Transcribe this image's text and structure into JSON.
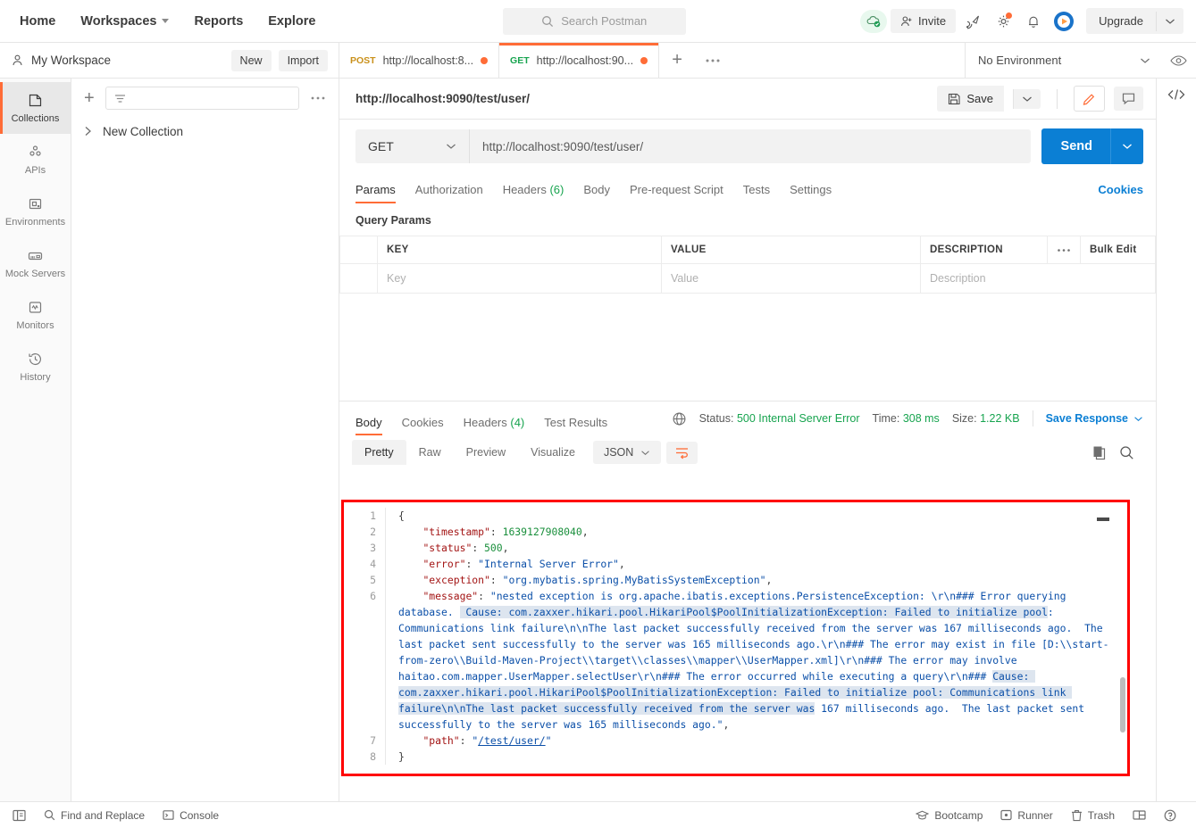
{
  "header": {
    "nav": [
      {
        "label": "Home",
        "icon": ""
      },
      {
        "label": "Workspaces",
        "icon": "chevron-down-icon"
      },
      {
        "label": "Reports",
        "icon": ""
      },
      {
        "label": "Explore",
        "icon": ""
      }
    ],
    "search_placeholder": "Search Postman",
    "invite_label": "Invite",
    "upgrade_label": "Upgrade",
    "icons": [
      "cloud-sync-icon",
      "invite-icon",
      "satellite-icon",
      "gear-icon",
      "bell-icon",
      "postman-avatar-icon",
      "chevron-down-icon"
    ]
  },
  "workspace": {
    "name": "My Workspace",
    "new_label": "New",
    "import_label": "Import"
  },
  "request_tabs": [
    {
      "method": "POST",
      "url": "http://localhost:8...",
      "unsaved": true,
      "active": false
    },
    {
      "method": "GET",
      "url": "http://localhost:90...",
      "unsaved": true,
      "active": true
    }
  ],
  "environment": {
    "selected": "No Environment"
  },
  "sidebar": {
    "items": [
      {
        "label": "Collections",
        "icon": "collections-icon",
        "active": true
      },
      {
        "label": "APIs",
        "icon": "apis-icon",
        "active": false
      },
      {
        "label": "Environments",
        "icon": "environments-icon",
        "active": false
      },
      {
        "label": "Mock Servers",
        "icon": "mock-servers-icon",
        "active": false
      },
      {
        "label": "Monitors",
        "icon": "monitors-icon",
        "active": false
      },
      {
        "label": "History",
        "icon": "history-icon",
        "active": false
      }
    ]
  },
  "collections": {
    "filter_placeholder": "",
    "items": [
      {
        "label": "New Collection"
      }
    ]
  },
  "request": {
    "title": "http://localhost:9090/test/user/",
    "save_label": "Save",
    "method": "GET",
    "url": "http://localhost:9090/test/user/",
    "send_label": "Send",
    "tabs": [
      {
        "label": "Params",
        "count": "",
        "active": true
      },
      {
        "label": "Authorization",
        "count": "",
        "active": false
      },
      {
        "label": "Headers",
        "count": "(6)",
        "active": false
      },
      {
        "label": "Body",
        "count": "",
        "active": false
      },
      {
        "label": "Pre-request Script",
        "count": "",
        "active": false
      },
      {
        "label": "Tests",
        "count": "",
        "active": false
      },
      {
        "label": "Settings",
        "count": "",
        "active": false
      }
    ],
    "cookies_label": "Cookies",
    "query_params_label": "Query Params",
    "params_table": {
      "headers": [
        "KEY",
        "VALUE",
        "DESCRIPTION"
      ],
      "bulk_edit_label": "Bulk Edit",
      "rows": [
        {
          "key": "Key",
          "value": "Value",
          "description": "Description"
        }
      ]
    }
  },
  "response": {
    "tabs": [
      {
        "label": "Body",
        "count": "",
        "active": true
      },
      {
        "label": "Cookies",
        "count": "",
        "active": false
      },
      {
        "label": "Headers",
        "count": "(4)",
        "active": false
      },
      {
        "label": "Test Results",
        "count": "",
        "active": false
      }
    ],
    "status_label": "Status:",
    "status_value": "500 Internal Server Error",
    "time_label": "Time:",
    "time_value": "308 ms",
    "size_label": "Size:",
    "size_value": "1.22 KB",
    "save_response_label": "Save Response",
    "format_tabs": [
      {
        "label": "Pretty",
        "active": true
      },
      {
        "label": "Raw",
        "active": false
      },
      {
        "label": "Preview",
        "active": false
      },
      {
        "label": "Visualize",
        "active": false
      }
    ],
    "content_type": "JSON",
    "body_lines": [
      {
        "num": "1",
        "segments": [
          {
            "t": "{",
            "c": "p"
          }
        ]
      },
      {
        "num": "2",
        "segments": [
          {
            "t": "    ",
            "c": "p"
          },
          {
            "t": "\"timestamp\"",
            "c": "k"
          },
          {
            "t": ": ",
            "c": "p"
          },
          {
            "t": "1639127908040",
            "c": "n"
          },
          {
            "t": ",",
            "c": "p"
          }
        ]
      },
      {
        "num": "3",
        "segments": [
          {
            "t": "    ",
            "c": "p"
          },
          {
            "t": "\"status\"",
            "c": "k"
          },
          {
            "t": ": ",
            "c": "p"
          },
          {
            "t": "500",
            "c": "n"
          },
          {
            "t": ",",
            "c": "p"
          }
        ]
      },
      {
        "num": "4",
        "segments": [
          {
            "t": "    ",
            "c": "p"
          },
          {
            "t": "\"error\"",
            "c": "k"
          },
          {
            "t": ": ",
            "c": "p"
          },
          {
            "t": "\"Internal Server Error\"",
            "c": "s"
          },
          {
            "t": ",",
            "c": "p"
          }
        ]
      },
      {
        "num": "5",
        "segments": [
          {
            "t": "    ",
            "c": "p"
          },
          {
            "t": "\"exception\"",
            "c": "k"
          },
          {
            "t": ": ",
            "c": "p"
          },
          {
            "t": "\"org.mybatis.spring.MyBatisSystemException\"",
            "c": "s"
          },
          {
            "t": ",",
            "c": "p"
          }
        ]
      },
      {
        "num": "6",
        "segments": [
          {
            "t": "    ",
            "c": "p"
          },
          {
            "t": "\"message\"",
            "c": "k"
          },
          {
            "t": ": ",
            "c": "p"
          },
          {
            "t": "\"nested exception is org.apache.ibatis.exceptions.PersistenceException: \\r\\n### Error querying database. ",
            "c": "s"
          },
          {
            "t": " Cause: com.zaxxer.hikari.pool.HikariPool$PoolInitializationException: Failed to initialize pool",
            "c": "s hl"
          },
          {
            "t": ": Communications link failure\\n\\nThe last packet successfully received from the server was 167 milliseconds ago.  The last packet sent successfully to the server was 165 milliseconds ago.\\r\\n### The error may exist in file [D:\\\\start-from-zero\\\\Build-Maven-Project\\\\target\\\\classes\\\\mapper\\\\UserMapper.xml]\\r\\n### The error may involve haitao.com.mapper.UserMapper.selectUser\\r\\n### The error occurred while executing a query\\r\\n### ",
            "c": "s"
          },
          {
            "t": "Cause: com.zaxxer.hikari.pool.HikariPool$PoolInitializationException: Failed to initialize pool: Communications link failure\\n\\nThe last packet successfully received from the server was",
            "c": "s hl"
          },
          {
            "t": " 167 milliseconds ago.  The last packet sent successfully to the server was 165 milliseconds ago.\"",
            "c": "s"
          },
          {
            "t": ",",
            "c": "p"
          }
        ]
      },
      {
        "num": "7",
        "segments": [
          {
            "t": "    ",
            "c": "p"
          },
          {
            "t": "\"path\"",
            "c": "k"
          },
          {
            "t": ": ",
            "c": "p"
          },
          {
            "t": "\"",
            "c": "s"
          },
          {
            "t": "/test/user/",
            "c": "s lnk"
          },
          {
            "t": "\"",
            "c": "s"
          }
        ]
      },
      {
        "num": "8",
        "segments": [
          {
            "t": "}",
            "c": "p"
          }
        ]
      }
    ]
  },
  "statusbar": {
    "left": [
      {
        "label": "",
        "icon": "sidebar-toggle-icon"
      },
      {
        "label": "Find and Replace",
        "icon": "search-icon"
      },
      {
        "label": "Console",
        "icon": "console-icon"
      }
    ],
    "right": [
      {
        "label": "Bootcamp",
        "icon": "bootcamp-icon"
      },
      {
        "label": "Runner",
        "icon": "runner-icon"
      },
      {
        "label": "Trash",
        "icon": "trash-icon"
      },
      {
        "label": "",
        "icon": "layout-icon"
      },
      {
        "label": "",
        "icon": "help-icon"
      }
    ]
  },
  "colors": {
    "accent": "#ff6c37",
    "link": "#0b7fd4",
    "success": "#17a44f",
    "annotation": "#ff0000"
  }
}
